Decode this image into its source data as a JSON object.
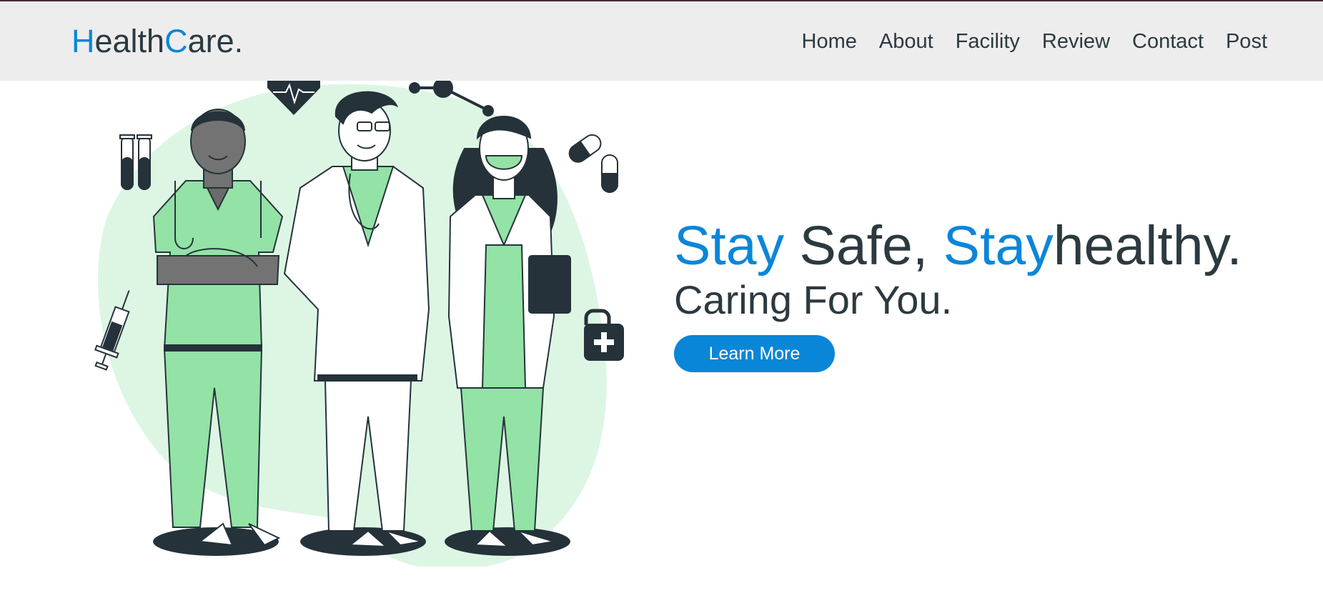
{
  "header": {
    "logo": {
      "part1": "H",
      "part2": "ealth",
      "part3": "C",
      "part4": "are."
    },
    "nav": [
      "Home",
      "About",
      "Facility",
      "Review",
      "Contact",
      "Post"
    ]
  },
  "hero": {
    "heading": {
      "w1": "Stay",
      "w2": " Safe, ",
      "w3": "Stay",
      "w4": "healthy."
    },
    "subheading": "Caring For You.",
    "button": "Learn More"
  },
  "colors": {
    "accent": "#0a86d9",
    "text": "#2c3a40",
    "header_bg": "#ededed",
    "illus_green": "#93e2a6",
    "illus_blob": "#ddf6e4"
  }
}
